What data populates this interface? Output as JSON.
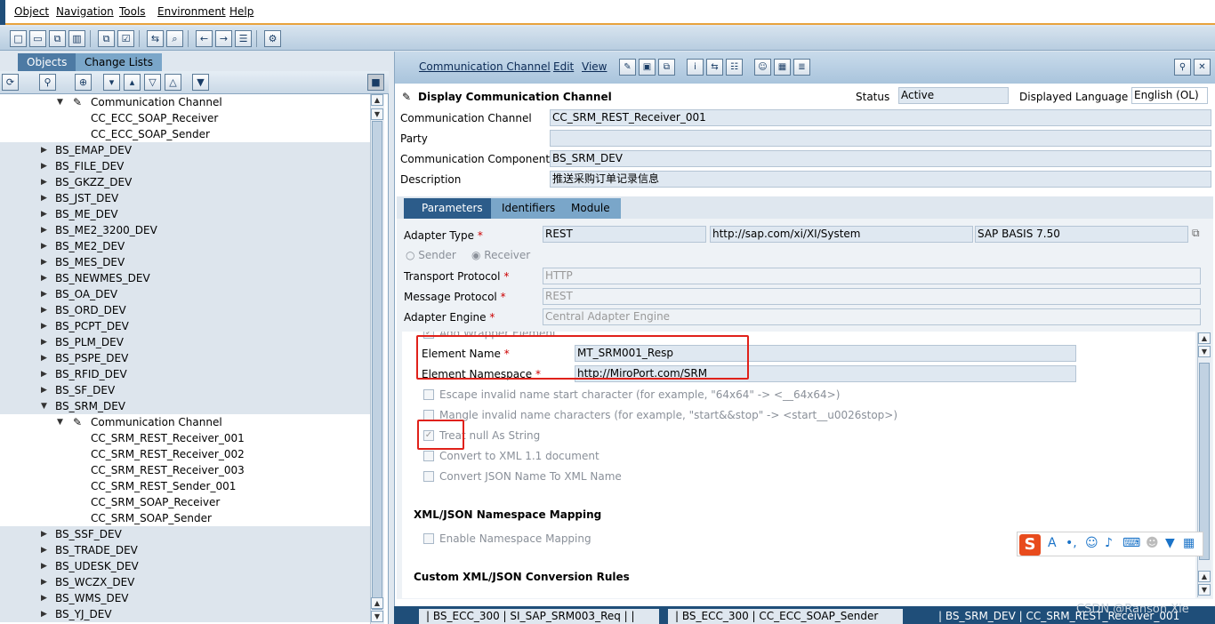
{
  "menu": [
    "Object",
    "Navigation",
    "Tools",
    "Environment",
    "Help"
  ],
  "left": {
    "tabs": [
      "Objects",
      "Change Lists"
    ],
    "tree": [
      {
        "label": "Communication Channel",
        "indent": 2,
        "expanded": true,
        "icon": "channel-icon",
        "bg": "w"
      },
      {
        "label": "CC_ECC_SOAP_Receiver",
        "indent": 3,
        "bg": "w"
      },
      {
        "label": "CC_ECC_SOAP_Sender",
        "indent": 3,
        "bg": "w"
      },
      {
        "label": "BS_EMAP_DEV",
        "indent": 1,
        "bg": "g"
      },
      {
        "label": "BS_FILE_DEV",
        "indent": 1,
        "bg": "g"
      },
      {
        "label": "BS_GKZZ_DEV",
        "indent": 1,
        "bg": "g"
      },
      {
        "label": "BS_JST_DEV",
        "indent": 1,
        "bg": "g"
      },
      {
        "label": "BS_ME_DEV",
        "indent": 1,
        "bg": "g"
      },
      {
        "label": "BS_ME2_3200_DEV",
        "indent": 1,
        "bg": "g"
      },
      {
        "label": "BS_ME2_DEV",
        "indent": 1,
        "bg": "g"
      },
      {
        "label": "BS_MES_DEV",
        "indent": 1,
        "bg": "g"
      },
      {
        "label": "BS_NEWMES_DEV",
        "indent": 1,
        "bg": "g"
      },
      {
        "label": "BS_OA_DEV",
        "indent": 1,
        "bg": "g"
      },
      {
        "label": "BS_ORD_DEV",
        "indent": 1,
        "bg": "g"
      },
      {
        "label": "BS_PCPT_DEV",
        "indent": 1,
        "bg": "g"
      },
      {
        "label": "BS_PLM_DEV",
        "indent": 1,
        "bg": "g"
      },
      {
        "label": "BS_PSPE_DEV",
        "indent": 1,
        "bg": "g"
      },
      {
        "label": "BS_RFID_DEV",
        "indent": 1,
        "bg": "g"
      },
      {
        "label": "BS_SF_DEV",
        "indent": 1,
        "bg": "g"
      },
      {
        "label": "BS_SRM_DEV",
        "indent": 1,
        "bg": "g",
        "expanded": true
      },
      {
        "label": "Communication Channel",
        "indent": 2,
        "expanded": true,
        "icon": "channel-icon",
        "bg": "w"
      },
      {
        "label": "CC_SRM_REST_Receiver_001",
        "indent": 3,
        "bg": "w"
      },
      {
        "label": "CC_SRM_REST_Receiver_002",
        "indent": 3,
        "bg": "w"
      },
      {
        "label": "CC_SRM_REST_Receiver_003",
        "indent": 3,
        "bg": "w"
      },
      {
        "label": "CC_SRM_REST_Sender_001",
        "indent": 3,
        "bg": "w"
      },
      {
        "label": "CC_SRM_SOAP_Receiver",
        "indent": 3,
        "bg": "w"
      },
      {
        "label": "CC_SRM_SOAP_Sender",
        "indent": 3,
        "bg": "w"
      },
      {
        "label": "BS_SSF_DEV",
        "indent": 1,
        "bg": "g"
      },
      {
        "label": "BS_TRADE_DEV",
        "indent": 1,
        "bg": "g"
      },
      {
        "label": "BS_UDESK_DEV",
        "indent": 1,
        "bg": "g"
      },
      {
        "label": "BS_WCZX_DEV",
        "indent": 1,
        "bg": "g"
      },
      {
        "label": "BS_WMS_DEV",
        "indent": 1,
        "bg": "g"
      },
      {
        "label": "BS_YJ_DEV",
        "indent": 1,
        "bg": "g"
      }
    ]
  },
  "right": {
    "menu": [
      "Communication Channel",
      "Edit",
      "View"
    ],
    "title": "Display Communication Channel",
    "status_label": "Status",
    "status_value": "Active",
    "lang_label": "Displayed Language",
    "lang_value": "English (OL)",
    "fields": {
      "channel_label": "Communication Channel",
      "channel_value": "CC_SRM_REST_Receiver_001",
      "party_label": "Party",
      "party_value": "",
      "component_label": "Communication Component",
      "component_value": "BS_SRM_DEV",
      "desc_label": "Description",
      "desc_value": "推送采购订单记录信息"
    },
    "tabs": [
      "Parameters",
      "Identifiers",
      "Module"
    ],
    "params": {
      "adapter_type_label": "Adapter Type",
      "adapter_type": "REST",
      "adapter_ns": "http://sap.com/xi/XI/System",
      "adapter_ver": "SAP BASIS 7.50",
      "sender": "Sender",
      "receiver": "Receiver",
      "transport_label": "Transport Protocol",
      "transport_value": "HTTP",
      "message_label": "Message Protocol",
      "message_value": "REST",
      "engine_label": "Adapter Engine",
      "engine_value": "Central Adapter Engine",
      "add_wrapper": "Add Wrapper Element",
      "element_name_label": "Element Name",
      "element_name_value": "MT_SRM001_Resp",
      "element_ns_label": "Element Namespace",
      "element_ns_value": "http://MiroPort.com/SRM",
      "escape": "Escape invalid name start character (for example, \"64x64\" -> <__64x64>)",
      "mangle": "Mangle invalid name characters (for example, \"start&&stop\" -> <start__u0026stop>)",
      "treat_null": "Treat null As String",
      "convert_xml": "Convert to XML 1.1 document",
      "convert_json": "Convert JSON Name To XML Name",
      "ns_mapping_title": "XML/JSON Namespace Mapping",
      "enable_ns": "Enable Namespace Mapping",
      "custom_rules": "Custom XML/JSON Conversion Rules"
    },
    "bottom_tabs": [
      "| BS_ECC_300 | SI_SAP_SRM003_Req | |",
      "| BS_ECC_300 | CC_ECC_SOAP_Sender",
      "| BS_SRM_DEV | CC_SRM_REST_Receiver_001"
    ]
  },
  "watermark": "CSDN @Ranson.Xie",
  "colors": {
    "accent": "#e8a33d",
    "highlight": "#e0211a",
    "tab_active": "#2c5c8a"
  }
}
